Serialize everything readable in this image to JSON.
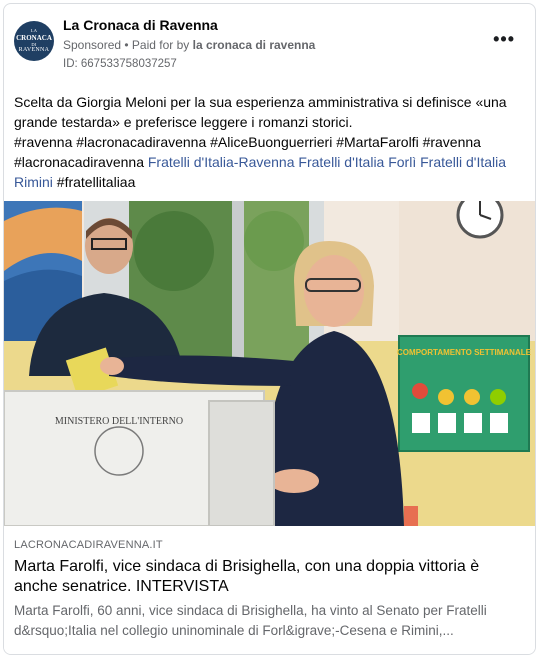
{
  "post": {
    "page_name": "La Cronaca di Ravenna",
    "sponsored": "Sponsored",
    "separator": " • ",
    "paid_for_prefix": "Paid for by ",
    "paid_for_name": "la cronaca di ravenna",
    "ad_id": "ID: 667533758037257",
    "more_icon": "more-options-icon",
    "avatar": {
      "line1": "LA",
      "line2": "CRONACA",
      "line3": "DI",
      "line4": "RAVENNA"
    },
    "body": {
      "sentence": "Scelta da Giorgia Meloni per la sua esperienza amministrativa si definisce «una grande testarda» e preferisce leggere i romanzi storici.",
      "hashtags": "#ravenna #lacronacadiravenna #AliceBuonguerrieri #MartaFarolfi #ravenna #lacronacadiravenna",
      "link1": "Fratelli d'Italia-Ravenna",
      "link2": "Fratelli d'Italia Forlì",
      "link3": "Fratelli d'Italia Rimini",
      "tail": "#fratellitaliaa"
    }
  },
  "image": {
    "ballot_box_text1": "MINISTERO DELL'INTERNO",
    "classroom_sign": "COMPORTAMENTO SETTIMANALE"
  },
  "link_preview": {
    "domain": "LACRONACADIRAVENNA.IT",
    "title": "Marta Farolfi, vice sindaca di Brisighella, con una doppia vittoria è anche senatrice. INTERVISTA",
    "description": "Marta Farolfi, 60 anni, vice sindaca di Brisighella, ha vinto al Senato per Fratelli d&rsquo;Italia nel collegio uninominale di Forl&igrave;-Cesena e Rimini,..."
  },
  "colors": {
    "link": "#385898",
    "secondary_text": "#65676b",
    "avatar_bg": "#1f3f63"
  }
}
